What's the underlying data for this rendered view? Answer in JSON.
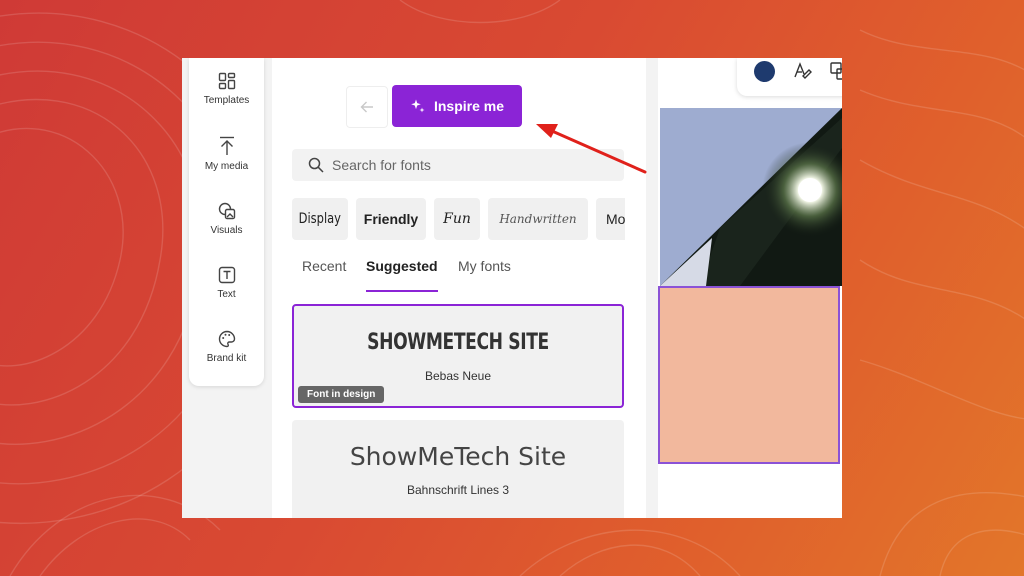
{
  "rail": {
    "items": [
      {
        "label": "Templates",
        "icon": "templates-icon"
      },
      {
        "label": "My media",
        "icon": "upload-icon"
      },
      {
        "label": "Visuals",
        "icon": "visuals-icon"
      },
      {
        "label": "Text",
        "icon": "text-icon"
      },
      {
        "label": "Brand kit",
        "icon": "palette-icon"
      }
    ]
  },
  "panel": {
    "back_icon": "arrow-left-icon",
    "inspire_label": "Inspire me",
    "inspire_icon": "sparkle-icon",
    "search_placeholder": "Search for fonts",
    "chips": [
      "Display",
      "Friendly",
      "Fun",
      "Handwritten",
      "Mo"
    ],
    "tabs": [
      "Recent",
      "Suggested",
      "My fonts"
    ],
    "active_tab": "Suggested",
    "fonts": [
      {
        "sample": "SHOWMETECH SITE",
        "name": "Bebas Neue",
        "badge": "Font in design",
        "selected": true
      },
      {
        "sample": "ShowMeTech Site",
        "name": "Bahnschrift Lines 3",
        "badge": "",
        "selected": false
      }
    ]
  },
  "toolbar": {
    "color_swatch": "#1e3a6e",
    "icons": [
      "text-style-icon",
      "effects-icon"
    ]
  },
  "colors": {
    "accent": "#8b24d6",
    "annotation_arrow": "#e0211b",
    "canvas_peach": "#f2b89d",
    "canvas_blue": "#9eacd0"
  }
}
